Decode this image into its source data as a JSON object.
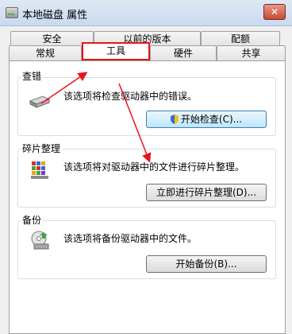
{
  "window": {
    "title": "本地磁盘 属性",
    "close_label": "✕"
  },
  "tabs_row1": [
    "安全",
    "以前的版本",
    "配额"
  ],
  "tabs_row2": [
    "常规",
    "工具",
    "硬件",
    "共享"
  ],
  "sections": {
    "check": {
      "title": "查错",
      "desc": "该选项将检查驱动器中的错误。",
      "button": "开始检查(C)..."
    },
    "defrag": {
      "title": "碎片整理",
      "desc": "该选项将对驱动器中的文件进行碎片整理。",
      "button": "立即进行碎片整理(D)..."
    },
    "backup": {
      "title": "备份",
      "desc": "该选项将备份驱动器中的文件。",
      "button": "开始备份(B)..."
    }
  },
  "annotation_color": "#e8141c"
}
